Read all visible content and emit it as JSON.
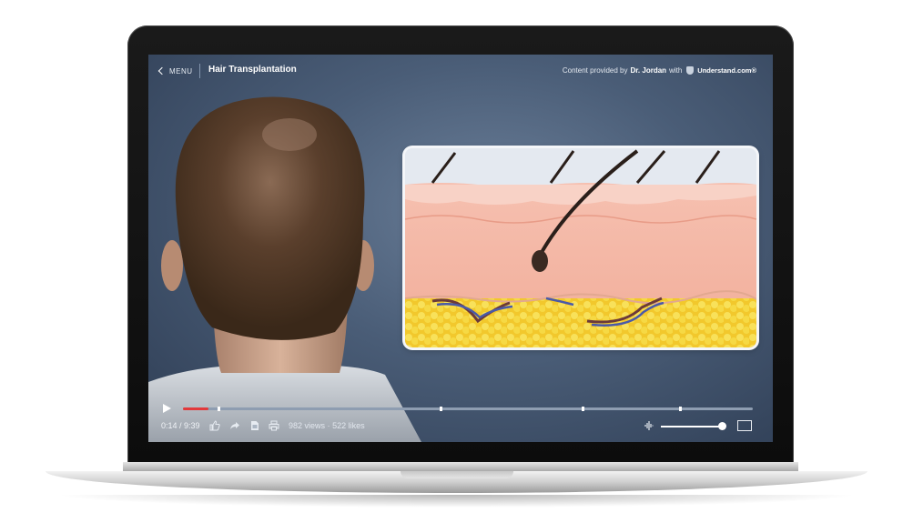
{
  "header": {
    "menu_label": "MENU",
    "title": "Hair Transplantation",
    "credit_prefix": "Content provided by",
    "credit_author": "Dr. Jordan",
    "credit_with": "with",
    "brand": "Understand.com®"
  },
  "player": {
    "progress": 0.024,
    "time": "0:14 / 9:39",
    "views": "982 views",
    "separator": "·",
    "likes": "522 likes",
    "volume": 0.93,
    "chapter_markers": [
      0.06,
      0.45,
      0.7,
      0.87
    ]
  },
  "colors": {
    "accent": "#e2393b",
    "screen_bg": "#4a5d77",
    "skin_dermis": "#f2b8a8",
    "fat_layer": "#f5d43a"
  },
  "icons": [
    "back-chevron-icon",
    "shield-icon",
    "play-icon",
    "like-icon",
    "share-icon",
    "document-icon",
    "print-icon",
    "volume-icon",
    "fullscreen-icon"
  ]
}
